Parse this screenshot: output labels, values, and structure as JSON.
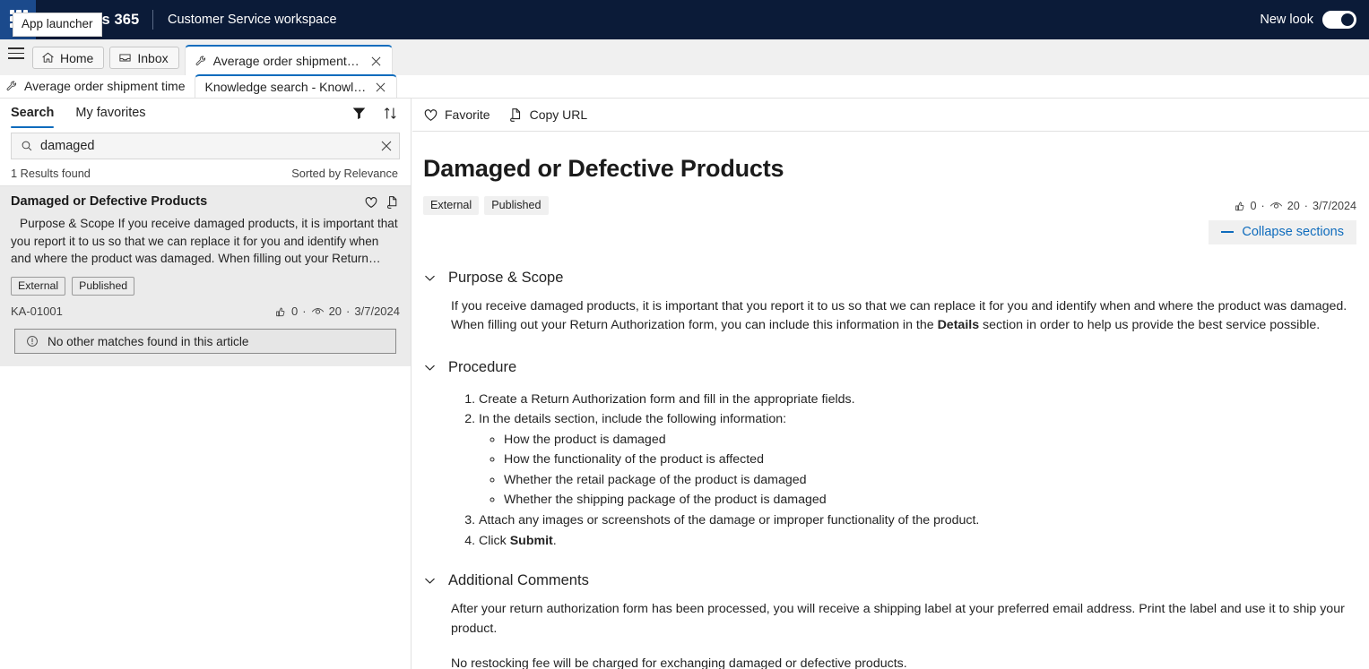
{
  "topbar": {
    "brand": "Dynamics 365",
    "workspace": "Customer Service workspace",
    "app_launcher_tooltip": "App launcher",
    "new_look_label": "New look",
    "new_look_state": "on",
    "bg_color": "#0b1b38"
  },
  "tabstrip": {
    "home_label": "Home",
    "inbox_label": "Inbox",
    "active_tab_label": "Average order shipment ti...",
    "accent_color": "#0f6cbd"
  },
  "subtabstrip": {
    "session_label": "Average order shipment time",
    "active_tab_label": "Knowledge search - Knowled..."
  },
  "left_panel": {
    "tabs": [
      {
        "label": "Search",
        "active": true
      },
      {
        "label": "My favorites",
        "active": false
      }
    ],
    "tools": [
      {
        "name": "filter-icon"
      },
      {
        "name": "sort-icon"
      }
    ],
    "search": {
      "value": "damaged",
      "placeholder": "Search"
    },
    "results_found": "1 Results found",
    "sort_label": "Sorted by Relevance",
    "result": {
      "title": "Damaged or Defective Products",
      "snippet": "Purpose & Scope If you receive damaged products, it is important that you report it to us so that we can replace it for you and identify when and where the product was damaged. When filling out your Return…",
      "badges": [
        "External",
        "Published"
      ],
      "article_number": "KA-01001",
      "likes": "0",
      "views": "20",
      "date": "3/7/2024",
      "separator": "·"
    },
    "no_match_text": "No other matches found in this article"
  },
  "content": {
    "toolbar": [
      {
        "label": "Favorite",
        "icon": "heart-icon"
      },
      {
        "label": "Copy URL",
        "icon": "copy-url-icon"
      }
    ],
    "title": "Damaged or Defective Products",
    "badges": [
      "External",
      "Published"
    ],
    "likes": "0",
    "views": "20",
    "date": "3/7/2024",
    "separator": "·",
    "collapse_label": "Collapse sections",
    "sections": [
      {
        "heading": "Purpose & Scope",
        "paragraphs": [
          "If you receive damaged products, it is important that you report it to us so that we can replace it for you and identify when and where the product was damaged. When filling out your Return Authorization form, you can include this information in the Details section in order to help us provide the best service possible."
        ],
        "bold_terms": [
          "Details"
        ]
      },
      {
        "heading": "Procedure",
        "steps": [
          {
            "text": "Create a Return Authorization form and fill in the appropriate fields."
          },
          {
            "text": "In the details section, include the following information:",
            "substeps": [
              "How the product is damaged",
              "How the functionality of the product is affected",
              "Whether the retail package of the product is damaged",
              "Whether the shipping package of the product is damaged"
            ]
          },
          {
            "text": "Attach any images or screenshots of the damage or improper functionality of the product."
          },
          {
            "text": "Click Submit.",
            "bold_term": "Submit"
          }
        ]
      },
      {
        "heading": "Additional Comments",
        "paragraphs": [
          "After your return authorization form has been processed, you will receive a shipping label at your preferred email address. Print the label and use it to ship your product.",
          "No restocking fee will be charged for exchanging damaged or defective products."
        ]
      }
    ]
  }
}
